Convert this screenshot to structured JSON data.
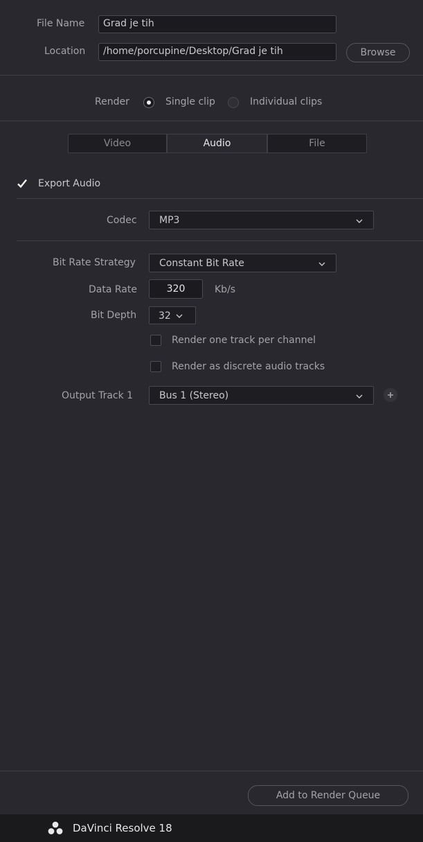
{
  "file": {
    "name_label": "File Name",
    "name_value": "Grad je tih",
    "location_label": "Location",
    "location_value": "/home/porcupine/Desktop/Grad je tih",
    "browse_label": "Browse"
  },
  "render": {
    "label": "Render",
    "option_single": "Single clip",
    "option_individual": "Individual clips",
    "selected": "Single clip"
  },
  "tabs": [
    {
      "label": "Video",
      "active": false
    },
    {
      "label": "Audio",
      "active": true
    },
    {
      "label": "File",
      "active": false
    }
  ],
  "audio": {
    "export_label": "Export Audio",
    "export_checked": true,
    "codec_label": "Codec",
    "codec_value": "MP3",
    "bitrate_strategy_label": "Bit Rate Strategy",
    "bitrate_strategy_value": "Constant Bit Rate",
    "data_rate_label": "Data Rate",
    "data_rate_value": "320",
    "data_rate_unit": "Kb/s",
    "bit_depth_label": "Bit Depth",
    "bit_depth_value": "32",
    "render_per_channel_label": "Render one track per channel",
    "render_discrete_label": "Render as discrete audio tracks",
    "output_track_label": "Output Track 1",
    "output_track_value": "Bus 1 (Stereo)"
  },
  "queue": {
    "add_label": "Add to Render Queue"
  },
  "footer": {
    "app_name": "DaVinci Resolve 18"
  },
  "icons": {
    "radio_selected": "radio-selected-icon",
    "chevron": "chevron-down-icon",
    "add": "plus-icon",
    "logo": "davinci-logo-icon",
    "check": "checkmark-icon"
  },
  "colors": {
    "background": "#28282e",
    "field_bg": "#1b1b1f",
    "footer_bg": "#1a1a1c",
    "text": "#c9c9cc",
    "label": "#a3a3a8"
  }
}
